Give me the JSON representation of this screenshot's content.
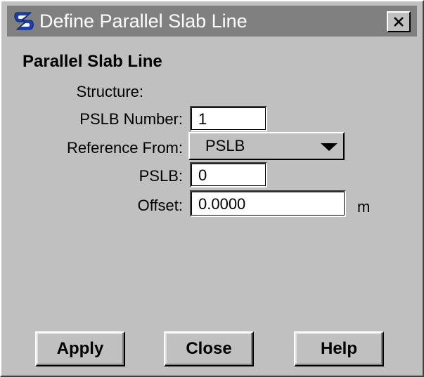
{
  "window": {
    "title": "Define Parallel Slab Line",
    "icon": "bentley-b-icon",
    "close_glyph": "×"
  },
  "section": {
    "title": "Parallel Slab Line"
  },
  "form": {
    "structure_label": "Structure:",
    "pslb_number_label": "PSLB Number:",
    "pslb_number_value": "1",
    "reference_from_label": "Reference From:",
    "reference_from_value": "PSLB",
    "pslb_label": "PSLB:",
    "pslb_value": "0",
    "offset_label": "Offset:",
    "offset_value": "0.0000",
    "offset_unit": "m"
  },
  "buttons": {
    "apply": "Apply",
    "close": "Close",
    "help": "Help"
  },
  "colors": {
    "titlebar": "#808080",
    "dialog_face": "#c0c0c0",
    "field_bg": "#ffffff",
    "icon_accent": "#1a3fb5"
  }
}
